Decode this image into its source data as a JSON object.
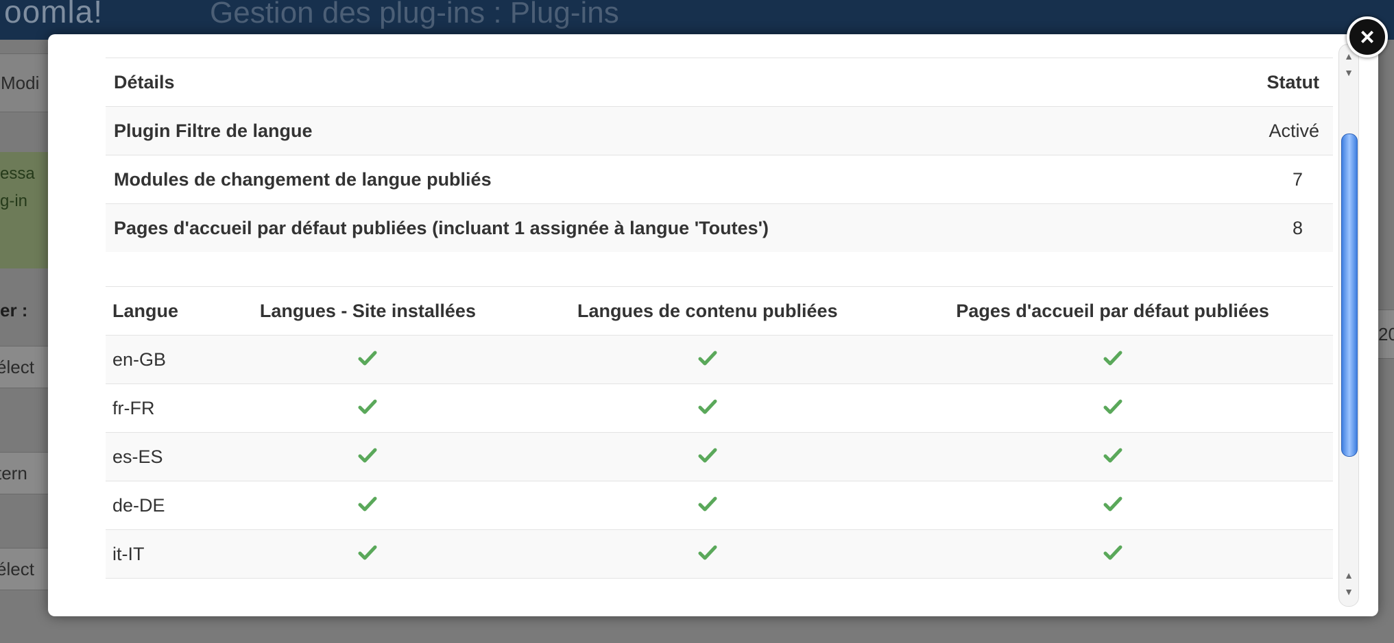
{
  "background": {
    "logo_fragment": "oomla!",
    "page_title": "Gestion des plug-ins : Plug-ins",
    "toolbar_button": "Modi",
    "message_line1": "essa",
    "message_line2": "g-in",
    "filter_label": "er :",
    "select1": "élect",
    "search_fragment": "tern",
    "select2": "élect",
    "right_field": "20"
  },
  "modal": {
    "close_icon": "close-icon",
    "status_table": {
      "headers": {
        "details": "Détails",
        "status": "Statut"
      },
      "rows": [
        {
          "label": "Plugin Filtre de langue",
          "value": "Activé"
        },
        {
          "label": "Modules de changement de langue publiés",
          "value": "7"
        },
        {
          "label": "Pages d'accueil par défaut publiées (incluant 1 assignée à langue 'Toutes')",
          "value": "8"
        }
      ]
    },
    "language_table": {
      "headers": {
        "language": "Langue",
        "site_installed": "Langues - Site installées",
        "content_published": "Langues de contenu publiées",
        "home_published": "Pages d'accueil par défaut publiées"
      },
      "rows": [
        {
          "code": "en-GB"
        },
        {
          "code": "fr-FR"
        },
        {
          "code": "es-ES"
        },
        {
          "code": "de-DE"
        },
        {
          "code": "it-IT"
        }
      ],
      "check_icon": "check-icon",
      "check_color": "#5aa85a"
    }
  },
  "colors": {
    "header_dark": "#17304d",
    "scroll_thumb": "#3f7fe0"
  }
}
